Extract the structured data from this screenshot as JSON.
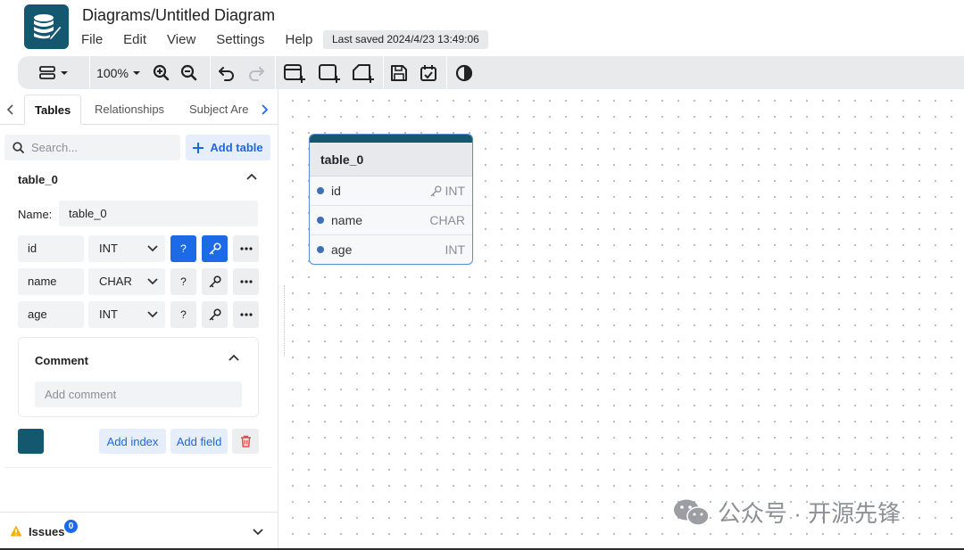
{
  "header": {
    "title": "Diagrams/Untitled Diagram",
    "menu": [
      "File",
      "Edit",
      "View",
      "Settings",
      "Help"
    ],
    "last_saved": "Last saved 2024/4/23 13:49:06"
  },
  "toolbar": {
    "zoom": "100%"
  },
  "sidebar": {
    "tabs": [
      "Tables",
      "Relationships",
      "Subject Are"
    ],
    "search_placeholder": "Search...",
    "add_table": "Add table",
    "table": {
      "header": "table_0",
      "name_label": "Name:",
      "name_value": "table_0",
      "fields": [
        {
          "name": "id",
          "type": "INT",
          "primary": true
        },
        {
          "name": "name",
          "type": "CHAR",
          "primary": false
        },
        {
          "name": "age",
          "type": "INT",
          "primary": false
        }
      ],
      "nullable_symbol": "?",
      "comment_title": "Comment",
      "comment_placeholder": "Add comment",
      "color": "#14586f",
      "add_index": "Add index",
      "add_field": "Add field"
    },
    "issues": {
      "label": "Issues",
      "count": "0"
    }
  },
  "diagram": {
    "table": {
      "title": "table_0",
      "header_color": "#14586f",
      "fields": [
        {
          "name": "id",
          "type": "INT"
        },
        {
          "name": "name",
          "type": "CHAR"
        },
        {
          "name": "age",
          "type": "INT"
        }
      ]
    }
  },
  "watermark": "公众号 · 开源先锋"
}
